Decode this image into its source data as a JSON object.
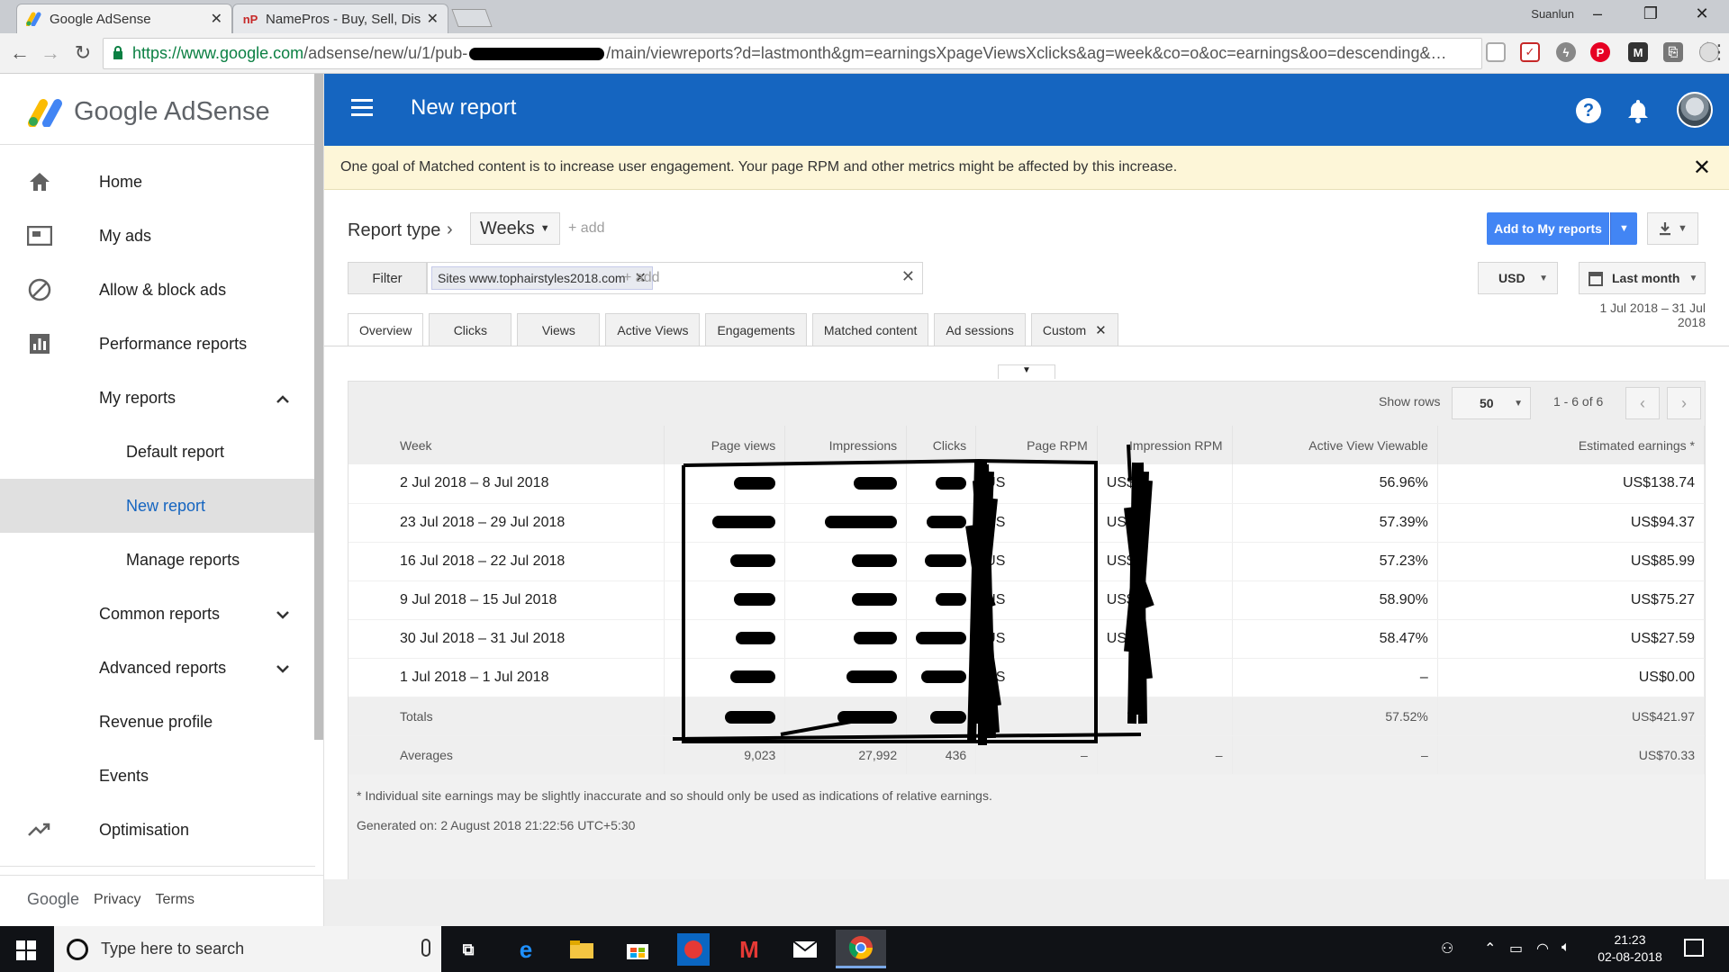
{
  "browser": {
    "tabs": [
      {
        "title": "Google AdSense",
        "favicon": "adsense-icon",
        "active": true
      },
      {
        "title": "NamePros - Buy, Sell, Dis",
        "favicon": "np-icon",
        "favicon_text": "nP",
        "active": false
      }
    ],
    "window_user": "Suanlun",
    "url_secure_part": "https://www.google.com",
    "url_before_redaction": "/adsense/new/u/1/pub-",
    "url_after_redaction": "/main/viewreports?d=lastmonth&gm=earningsXpageViewsXclicks&ag=week&co=o&oc=earnings&oo=descending&…"
  },
  "sidebar": {
    "logo_text": "Google AdSense",
    "items": [
      {
        "label": "Home",
        "icon": "home-icon"
      },
      {
        "label": "My ads",
        "icon": "my-ads-icon"
      },
      {
        "label": "Allow & block ads",
        "icon": "block-icon"
      },
      {
        "label": "Performance reports",
        "icon": "bar-chart-icon"
      },
      {
        "label": "My reports",
        "icon": "chevron-up-icon",
        "expanded": true
      },
      {
        "label": "Default report",
        "sub": true
      },
      {
        "label": "New report",
        "sub": true,
        "selected": true
      },
      {
        "label": "Manage reports",
        "sub": true
      },
      {
        "label": "Common reports",
        "icon": "chevron-down-icon"
      },
      {
        "label": "Advanced reports",
        "icon": "chevron-down-icon"
      },
      {
        "label": "Revenue profile"
      },
      {
        "label": "Events"
      },
      {
        "label": "Optimisation",
        "icon": "trending-up-icon"
      }
    ],
    "footer": {
      "brand": "Google",
      "privacy": "Privacy",
      "terms": "Terms"
    }
  },
  "header": {
    "title": "New report"
  },
  "notice": {
    "text": "One goal of Matched content is to increase user engagement. Your page RPM and other metrics might be affected by this increase."
  },
  "report": {
    "report_type_label": "Report type",
    "dimension": "Weeks",
    "add_label": "+ add",
    "add_to_my_reports": "Add to My reports",
    "filter_label": "Filter",
    "filter_chip": "Sites www.tophairstyles2018.com",
    "filter_add": "+ add",
    "currency": "USD",
    "date_preset": "Last month",
    "date_range": "1 Jul 2018 – 31 Jul 2018",
    "tabs": [
      "Overview",
      "Clicks",
      "Views",
      "Active Views",
      "Engagements",
      "Matched content",
      "Ad sessions",
      "Custom"
    ],
    "active_tab": "Overview"
  },
  "table": {
    "show_rows_label": "Show rows",
    "show_rows_value": "50",
    "range_label": "1 - 6 of 6",
    "columns": [
      "Week",
      "Page views",
      "Impressions",
      "Clicks",
      "Page RPM",
      "Impression RPM",
      "Active View Viewable",
      "Estimated earnings *"
    ],
    "rows": [
      {
        "week": "2 Jul 2018 – 8 Jul 2018",
        "rpm_prefix": "US",
        "irpm_prefix": "US$",
        "viewable": "56.96%",
        "earnings": "US$138.74"
      },
      {
        "week": "23 Jul 2018 – 29 Jul 2018",
        "rpm_prefix": "US",
        "irpm_prefix": "US$",
        "viewable": "57.39%",
        "earnings": "US$94.37"
      },
      {
        "week": "16 Jul 2018 – 22 Jul 2018",
        "rpm_prefix": "US",
        "irpm_prefix": "US$",
        "viewable": "57.23%",
        "earnings": "US$85.99"
      },
      {
        "week": "9 Jul 2018 – 15 Jul 2018",
        "rpm_prefix": "US",
        "irpm_prefix": "US$",
        "viewable": "58.90%",
        "earnings": "US$75.27"
      },
      {
        "week": "30 Jul 2018 – 31 Jul 2018",
        "rpm_prefix": "US",
        "irpm_prefix": "US$",
        "viewable": "58.47%",
        "earnings": "US$27.59"
      },
      {
        "week": "1 Jul 2018 – 1 Jul 2018",
        "rpm_prefix": "US",
        "irpm_prefix": "",
        "viewable": "–",
        "earnings": "US$0.00"
      }
    ],
    "totals": {
      "label": "Totals",
      "viewable": "57.52%",
      "earnings": "US$421.97"
    },
    "averages": {
      "label": "Averages",
      "page_views": "9,023",
      "impressions": "27,992",
      "clicks": "436",
      "page_rpm": "–",
      "impression_rpm": "–",
      "viewable": "–",
      "earnings": "US$70.33"
    }
  },
  "footnote": "* Individual site earnings may be slightly inaccurate and so should only be used as indications of relative earnings.",
  "generated": "Generated on: 2 August 2018 21:22:56 UTC+5:30",
  "taskbar": {
    "search_placeholder": "Type here to search",
    "time": "21:23",
    "date": "02-08-2018"
  },
  "colors": {
    "header_blue": "#1565c0",
    "primary_button": "#4285f4",
    "notice_bg": "#fdf6d8",
    "selected_nav": "#1565c0"
  }
}
